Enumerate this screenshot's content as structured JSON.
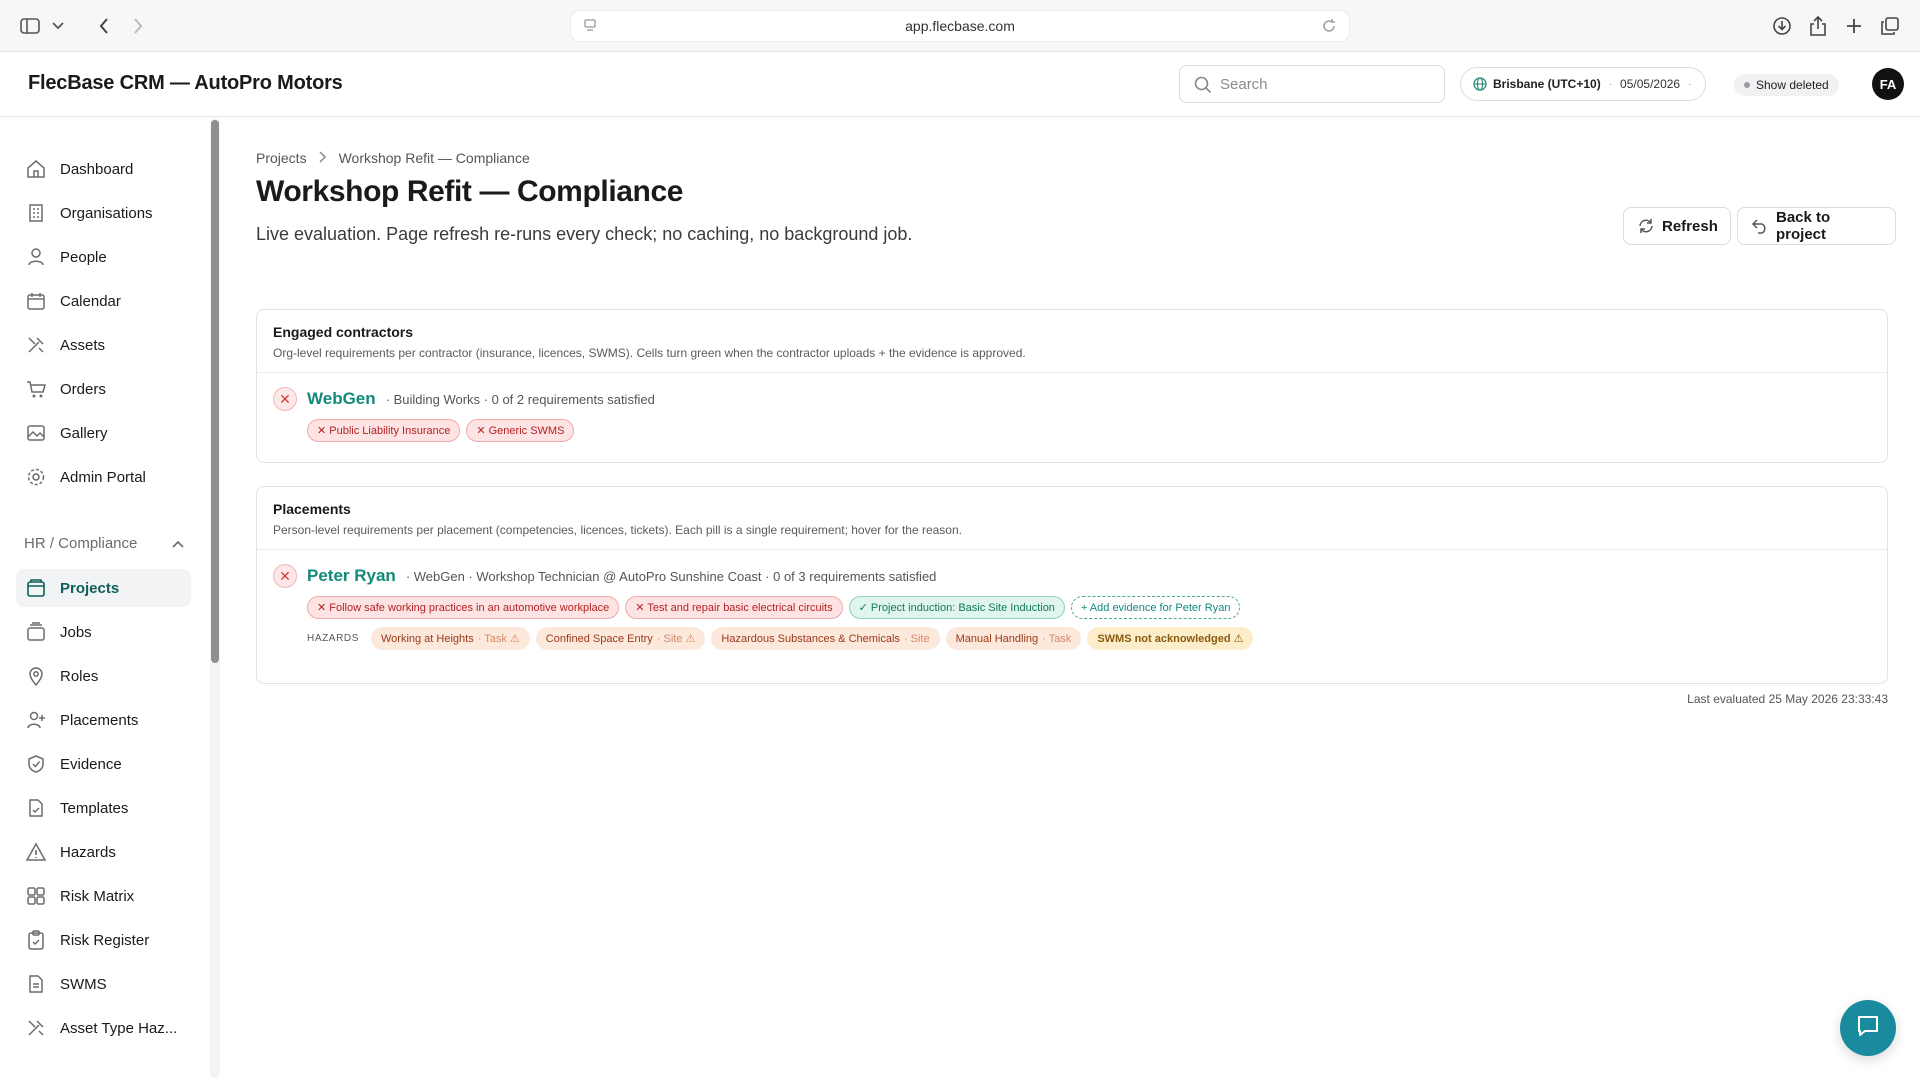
{
  "browser": {
    "url": "app.flecbase.com"
  },
  "header": {
    "app_title": "FlecBase CRM — AutoPro Motors",
    "search_placeholder": "Search",
    "timezone": "Brisbane (UTC+10)",
    "date": "05/05/2026",
    "show_deleted": "Show deleted",
    "avatar_initials": "FA"
  },
  "sidebar": {
    "items": [
      {
        "label": "Dashboard",
        "icon": "home-icon"
      },
      {
        "label": "Organisations",
        "icon": "building-icon"
      },
      {
        "label": "People",
        "icon": "person-icon"
      },
      {
        "label": "Calendar",
        "icon": "calendar-icon"
      },
      {
        "label": "Assets",
        "icon": "tools-icon"
      },
      {
        "label": "Orders",
        "icon": "cart-icon"
      },
      {
        "label": "Gallery",
        "icon": "image-icon"
      },
      {
        "label": "Admin Portal",
        "icon": "gear-icon"
      }
    ],
    "section_label": "HR / Compliance",
    "section_items": [
      {
        "label": "Projects",
        "icon": "folder-icon",
        "active": true
      },
      {
        "label": "Jobs",
        "icon": "stack-icon"
      },
      {
        "label": "Roles",
        "icon": "pin-icon"
      },
      {
        "label": "Placements",
        "icon": "person-plus-icon"
      },
      {
        "label": "Evidence",
        "icon": "shield-check-icon"
      },
      {
        "label": "Templates",
        "icon": "file-check-icon"
      },
      {
        "label": "Hazards",
        "icon": "warning-icon"
      },
      {
        "label": "Risk Matrix",
        "icon": "grid-icon"
      },
      {
        "label": "Risk Register",
        "icon": "clipboard-icon"
      },
      {
        "label": "SWMS",
        "icon": "document-icon"
      },
      {
        "label": "Asset Type Haz...",
        "icon": "tools-icon"
      }
    ]
  },
  "main": {
    "breadcrumb": [
      "Projects",
      "Workshop Refit — Compliance"
    ],
    "title": "Workshop Refit — Compliance",
    "subtitle": "Live evaluation. Page refresh re-runs every check; no caching, no background job.",
    "refresh_label": "Refresh",
    "back_label": "Back to project",
    "contractors": {
      "title": "Engaged contractors",
      "description": "Org-level requirements per contractor (insurance, licences, SWMS). Cells turn green when the contractor uploads + the evidence is approved.",
      "rows": [
        {
          "name": "WebGen",
          "meta": "· Building Works · 0 of 2 requirements satisfied",
          "pills": [
            "✕ Public Liability Insurance",
            "✕ Generic SWMS"
          ]
        }
      ]
    },
    "placements": {
      "title": "Placements",
      "description": "Person-level requirements per placement (competencies, licences, tickets). Each pill is a single requirement; hover for the reason.",
      "rows": [
        {
          "name": "Peter Ryan",
          "meta": "· WebGen · Workshop Technician @ AutoPro Sunshine Coast · 0 of 3 requirements satisfied",
          "pills_red": [
            "✕ Follow safe working practices in an automotive workplace",
            "✕ Test and repair basic electrical circuits"
          ],
          "pill_green": "✓ Project induction: Basic Site Induction",
          "pill_add": "+ Add evidence for Peter Ryan",
          "hazards_label": "HAZARDS",
          "hazards": [
            {
              "name": "Working at Heights",
              "sub": "· Task ⚠"
            },
            {
              "name": "Confined Space Entry",
              "sub": "· Site ⚠"
            },
            {
              "name": "Hazardous Substances & Chemicals",
              "sub": "· Site"
            },
            {
              "name": "Manual Handling",
              "sub": "· Task"
            }
          ],
          "swms_warning": "SWMS not acknowledged ⚠"
        }
      ]
    },
    "last_evaluated": "Last evaluated 25 May 2026 23:33:43"
  }
}
